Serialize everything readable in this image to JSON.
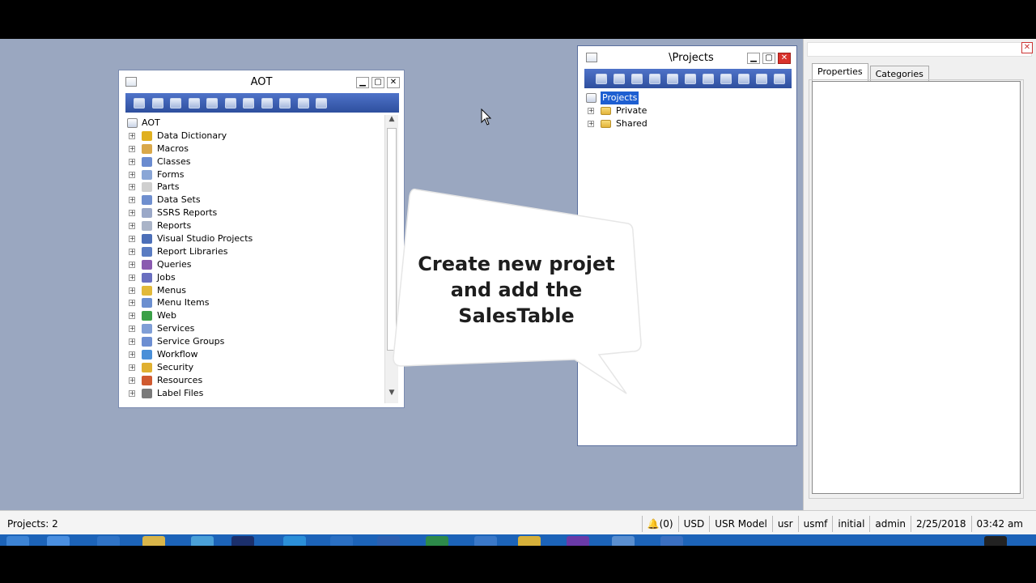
{
  "aot_window": {
    "title": "AOT",
    "root_label": "AOT",
    "items": [
      {
        "label": "Data Dictionary",
        "icon": "data-dictionary-icon",
        "color": "#e0b020"
      },
      {
        "label": "Macros",
        "icon": "macros-icon",
        "color": "#d9a84a"
      },
      {
        "label": "Classes",
        "icon": "classes-icon",
        "color": "#6a8bd0"
      },
      {
        "label": "Forms",
        "icon": "forms-icon",
        "color": "#8aa6d6"
      },
      {
        "label": "Parts",
        "icon": "parts-icon",
        "color": "#cfcfcf"
      },
      {
        "label": "Data Sets",
        "icon": "data-sets-icon",
        "color": "#6f8fcf"
      },
      {
        "label": "SSRS Reports",
        "icon": "ssrs-reports-icon",
        "color": "#9aa8c8"
      },
      {
        "label": "Reports",
        "icon": "reports-icon",
        "color": "#aab4c8"
      },
      {
        "label": "Visual Studio Projects",
        "icon": "visual-studio-projects-icon",
        "color": "#4c6fb8"
      },
      {
        "label": "Report Libraries",
        "icon": "report-libraries-icon",
        "color": "#5a7cc2"
      },
      {
        "label": "Queries",
        "icon": "queries-icon",
        "color": "#8a5ab0"
      },
      {
        "label": "Jobs",
        "icon": "jobs-icon",
        "color": "#6a6fc0"
      },
      {
        "label": "Menus",
        "icon": "menus-icon",
        "color": "#e2b93a"
      },
      {
        "label": "Menu Items",
        "icon": "menu-items-icon",
        "color": "#6b8fd0"
      },
      {
        "label": "Web",
        "icon": "web-icon",
        "color": "#3aa047"
      },
      {
        "label": "Services",
        "icon": "services-icon",
        "color": "#7f9ed6"
      },
      {
        "label": "Service Groups",
        "icon": "service-groups-icon",
        "color": "#6c8ed2"
      },
      {
        "label": "Workflow",
        "icon": "workflow-icon",
        "color": "#4a8fd8"
      },
      {
        "label": "Security",
        "icon": "security-icon",
        "color": "#e0b030"
      },
      {
        "label": "Resources",
        "icon": "resources-icon",
        "color": "#d05a30"
      },
      {
        "label": "Label Files",
        "icon": "label-files-icon",
        "color": "#7a7a7a"
      }
    ]
  },
  "projects_window": {
    "title": "\\Projects",
    "root_label": "Projects",
    "items": [
      {
        "label": "Private",
        "icon": "folder-icon"
      },
      {
        "label": "Shared",
        "icon": "folder-icon"
      }
    ]
  },
  "properties_pane": {
    "tabs": [
      {
        "label": "Properties"
      },
      {
        "label": "Categories"
      }
    ]
  },
  "callout": {
    "lines": [
      "Create new projet",
      "and add the",
      "SalesTable"
    ]
  },
  "statusbar": {
    "projects_label": "Projects:  2",
    "notifications": "(0)",
    "currency": "USD",
    "model": "USR Model",
    "layer": "usr",
    "company": "usmf",
    "partition": "initial",
    "user": "admin",
    "date": "2/25/2018",
    "time": "03:42 am"
  },
  "colors": {
    "desktop": "#9aa7c0",
    "toolbar": "#2e4f9e",
    "selection": "#1e5fd1",
    "close_button": "#d9322c",
    "taskbar": "#1c63b8"
  }
}
